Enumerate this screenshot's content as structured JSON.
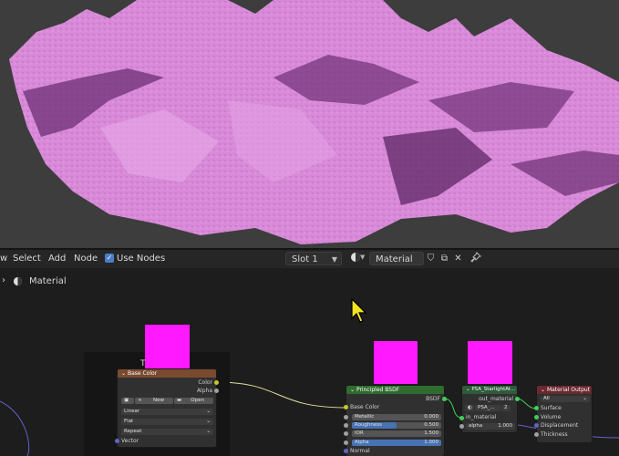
{
  "header": {
    "menu_view": "w",
    "menu_select": "Select",
    "menu_add": "Add",
    "menu_node": "Node",
    "use_nodes_label": "Use Nodes",
    "slot_value": "Slot 1",
    "material_name": "Material"
  },
  "breadcrumb": {
    "material_label": "Material"
  },
  "nodes": {
    "image_texture": {
      "partial_title": "T",
      "header": "Base Color",
      "out_color": "Color",
      "out_alpha": "Alpha",
      "new_label": "New",
      "open_label": "Open",
      "interpolation": "Linear",
      "projection": "Flat",
      "extension": "Repeat",
      "in_vector": "Vector"
    },
    "principled": {
      "header": "Principled BSDF",
      "out_bsdf": "BSDF",
      "base_color": "Base Color",
      "metallic_label": "Metallic",
      "metallic_value": "0.000",
      "roughness_label": "Roughness",
      "roughness_value": "0.500",
      "roughness_fill": 0.5,
      "ior_label": "IOR",
      "ior_value": "1.500",
      "alpha_label": "Alpha",
      "alpha_value": "1.000",
      "alpha_fill": 1.0,
      "normal": "Normal"
    },
    "group": {
      "header": "PSA_StarlightAt...",
      "out_material": "out_material",
      "datablock": "PSA_...",
      "users": "2",
      "in_material": "in_material",
      "alpha_label": "alpha",
      "alpha_value": "1.000"
    },
    "output": {
      "header": "Material Output",
      "target": "All",
      "surface": "Surface",
      "volume": "Volume",
      "displacement": "Displacement",
      "thickness": "Thickness"
    }
  },
  "colors": {
    "terrain": "#d787d7",
    "swatch": "#ff19ff",
    "texture_header": "#7a4a2e",
    "shader_header": "#2f6b2f",
    "group_header": "#2e5b3a",
    "output_header": "#6b2830",
    "socket_color": "#c7c729",
    "socket_shader": "#3fcf5a",
    "socket_float": "#a0a0a0",
    "socket_vector": "#6363c7"
  }
}
